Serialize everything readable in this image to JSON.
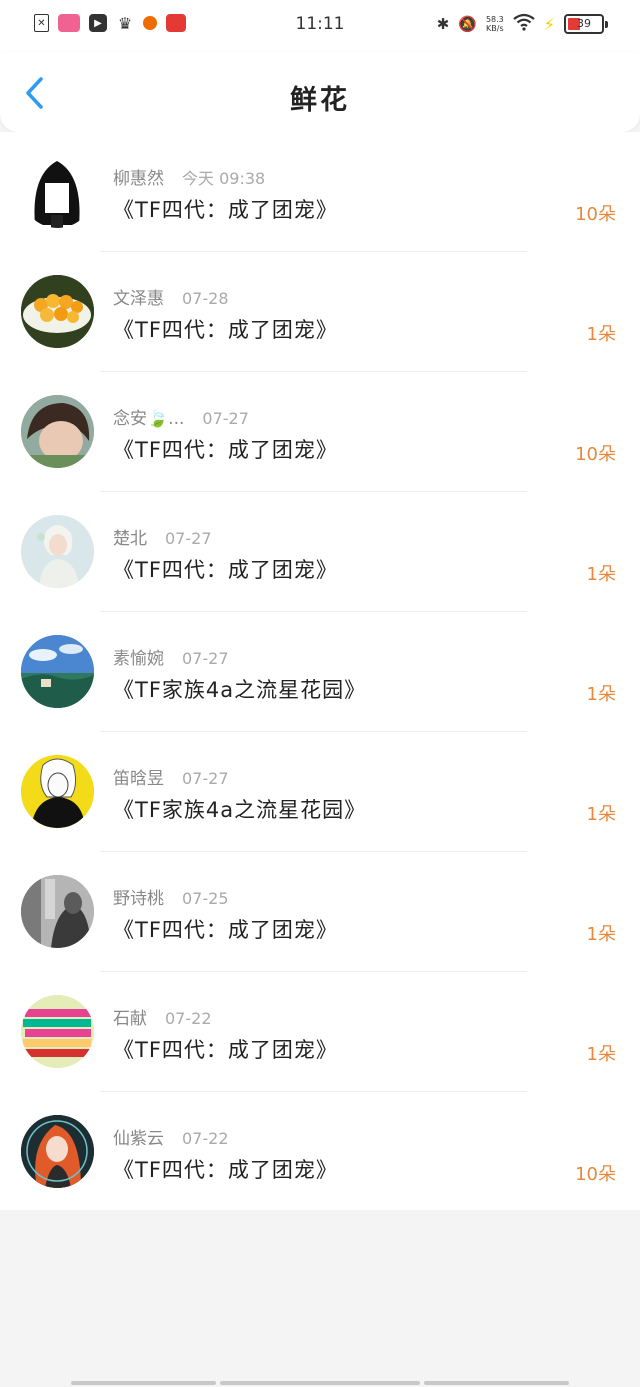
{
  "status_bar": {
    "time": "11:11",
    "net_speed": "58.3",
    "net_unit": "KB/s",
    "battery": "39"
  },
  "header": {
    "title": "鲜花"
  },
  "rows": [
    {
      "name": "柳惠然",
      "time": "今天 09:38",
      "title": "《TF四代：成了团宠》",
      "count": "10朵"
    },
    {
      "name": "文泽惠",
      "time": "07-28",
      "title": "《TF四代：成了团宠》",
      "count": "1朵"
    },
    {
      "name": "念安🍃...",
      "time": "07-27",
      "title": "《TF四代：成了团宠》",
      "count": "10朵"
    },
    {
      "name": "楚北",
      "time": "07-27",
      "title": "《TF四代：成了团宠》",
      "count": "1朵"
    },
    {
      "name": "素愉婉",
      "time": "07-27",
      "title": "《TF家族4a之流星花园》",
      "count": "1朵"
    },
    {
      "name": "笛晗昱",
      "time": "07-27",
      "title": "《TF家族4a之流星花园》",
      "count": "1朵"
    },
    {
      "name": "野诗桃",
      "time": "07-25",
      "title": "《TF四代：成了团宠》",
      "count": "1朵"
    },
    {
      "name": "石献",
      "time": "07-22",
      "title": "《TF四代：成了团宠》",
      "count": "1朵"
    },
    {
      "name": "仙紫云",
      "time": "07-22",
      "title": "《TF四代：成了团宠》",
      "count": "10朵"
    }
  ],
  "colors": {
    "accent_blue": "#2f9bf0",
    "count_orange": "#e8883a"
  }
}
